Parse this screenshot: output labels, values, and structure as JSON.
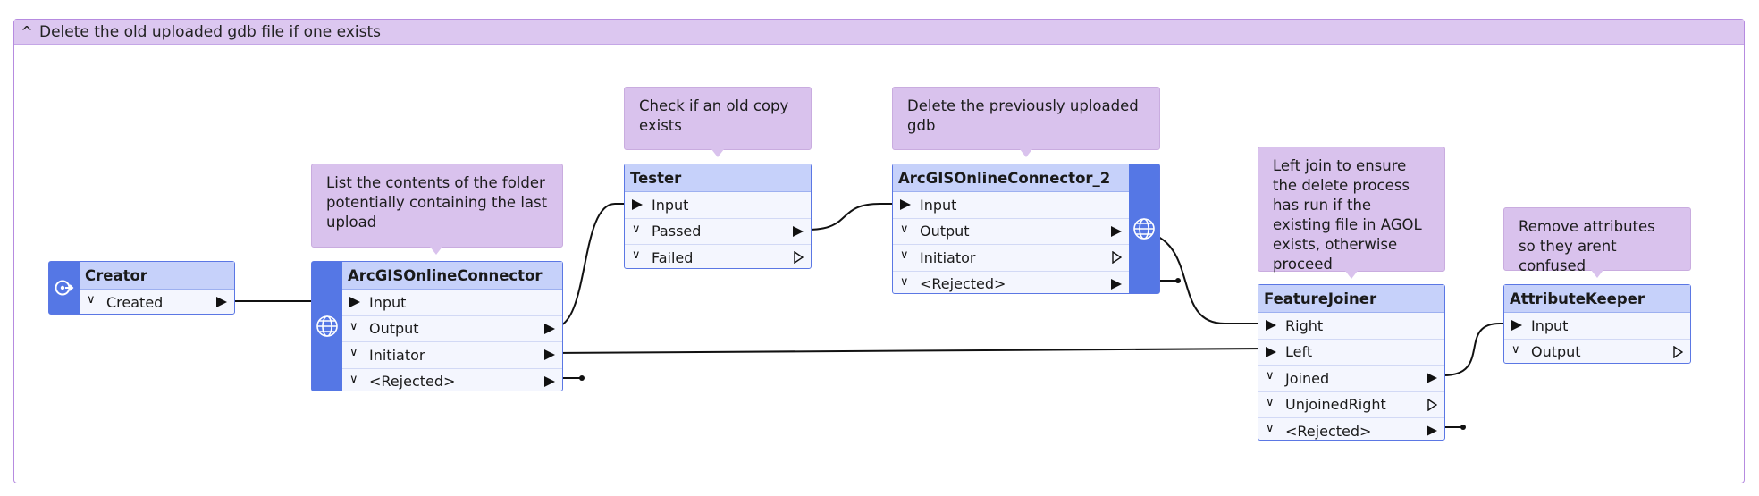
{
  "bookmark": {
    "collapse_icon": "^",
    "title": "Delete the old uploaded gdb file if one exists"
  },
  "annotations": {
    "list_contents": "List the contents of the folder potentially containing the last upload",
    "check_copy": "Check if an old copy exists",
    "delete_prev": "Delete the previously uploaded gdb",
    "left_join": "Left join to ensure the delete process has run if the existing file in AGOL exists, otherwise proceed",
    "remove_attrs": "Remove attributes so they arent confused"
  },
  "transformers": {
    "creator": {
      "name": "Creator",
      "ports": [
        "Created"
      ]
    },
    "agol1": {
      "name": "ArcGISOnlineConnector",
      "ports": [
        "Input",
        "Output",
        "Initiator",
        "<Rejected>"
      ]
    },
    "tester": {
      "name": "Tester",
      "ports": [
        "Input",
        "Passed",
        "Failed"
      ]
    },
    "agol2": {
      "name": "ArcGISOnlineConnector_2",
      "ports": [
        "Input",
        "Output",
        "Initiator",
        "<Rejected>"
      ]
    },
    "joiner": {
      "name": "FeatureJoiner",
      "ports": [
        "Right",
        "Left",
        "Joined",
        "UnjoinedRight",
        "<Rejected>"
      ]
    },
    "keeper": {
      "name": "AttributeKeeper",
      "ports": [
        "Input",
        "Output"
      ]
    }
  },
  "colors": {
    "bookmark_border": "#b68be0",
    "bookmark_header": "#dcc7f0",
    "annotation_fill": "#d9c2ed",
    "transformer_header": "#c6d1fa",
    "transformer_body": "#f4f6fe",
    "transformer_side": "#5577e5",
    "connection": "#111111"
  },
  "icons": {
    "creator": "creator-icon",
    "agol": "globe-icon"
  }
}
